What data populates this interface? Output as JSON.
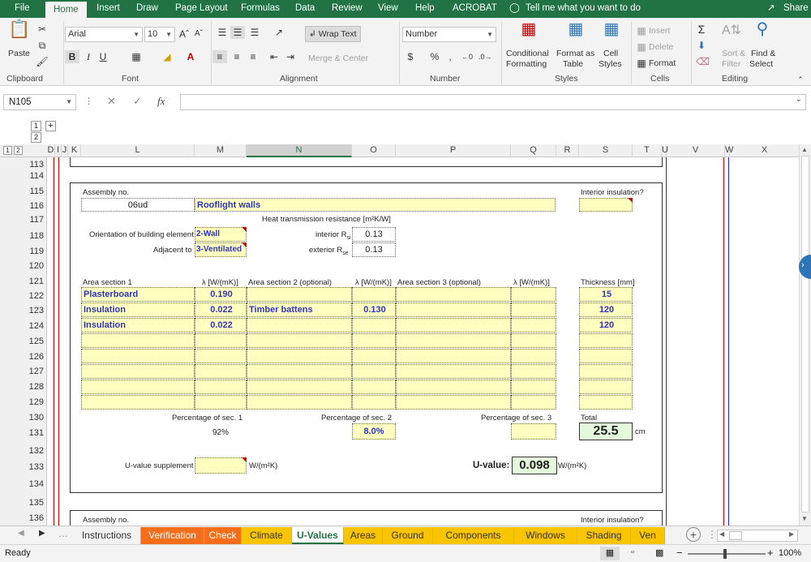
{
  "menu": {
    "items": [
      "File",
      "Home",
      "Insert",
      "Draw",
      "Page Layout",
      "Formulas",
      "Data",
      "Review",
      "View",
      "Help",
      "ACROBAT"
    ],
    "tell_me": "Tell me what you want to do",
    "share": "Share"
  },
  "ribbon": {
    "clipboard": {
      "paste": "Paste",
      "label": "Clipboard"
    },
    "font": {
      "name": "Arial",
      "size": "10",
      "label": "Font",
      "bold": "B",
      "italic": "I",
      "underline": "U"
    },
    "alignment": {
      "wrap": "Wrap Text",
      "merge": "Merge & Center",
      "label": "Alignment"
    },
    "number": {
      "format": "Number",
      "label": "Number",
      "currency": "$",
      "percent": "%",
      "comma": ","
    },
    "styles": {
      "conditional_1": "Conditional",
      "conditional_2": "Formatting",
      "format_table_1": "Format as",
      "format_table_2": "Table",
      "cell_styles_1": "Cell",
      "cell_styles_2": "Styles",
      "label": "Styles"
    },
    "cells": {
      "insert": "Insert",
      "delete": "Delete",
      "format": "Format",
      "label": "Cells"
    },
    "editing": {
      "sort_1": "Sort &",
      "sort_2": "Filter",
      "find_1": "Find &",
      "find_2": "Select",
      "label": "Editing"
    }
  },
  "formula_bar": {
    "name_box": "N105",
    "fx": "fx",
    "content": ""
  },
  "outline": {
    "levels": [
      "1",
      "2"
    ],
    "expand": "+"
  },
  "columns": [
    "D",
    "I",
    "J",
    "K",
    "L",
    "M",
    "N",
    "O",
    "P",
    "Q",
    "R",
    "S",
    "T",
    "U",
    "V",
    "W",
    "X"
  ],
  "rows": [
    "113",
    "114",
    "115",
    "116",
    "117",
    "118",
    "119",
    "120",
    "121",
    "122",
    "123",
    "124",
    "125",
    "126",
    "127",
    "128",
    "129",
    "130",
    "131",
    "132",
    "133",
    "134",
    "135",
    "136"
  ],
  "sheet": {
    "assembly_label": "Assembly no.",
    "assembly_no": "06ud",
    "assembly_name": "Rooflight walls",
    "interior_insulation_label": "Interior insulation?",
    "heat_label": "Heat transmission resistance  [m²K/W]",
    "orientation_label": "Orientation of building element",
    "orientation_value": "2-Wall",
    "adjacent_label": "Adjacent to",
    "adjacent_value": "3-Ventilated",
    "interior_r_label": "interior R",
    "interior_r_sub": "si",
    "interior_r_value": "0.13",
    "exterior_r_label": "exterior R",
    "exterior_r_sub": "se",
    "exterior_r_value": "0.13",
    "area1_label": "Area section 1",
    "lambda_label": "λ [W/(mK)]",
    "area2_label": "Area section 2 (optional)",
    "area3_label": "Area section 3 (optional)",
    "thickness_label": "Thickness [mm]",
    "layers": [
      {
        "a1": "Plasterboard",
        "l1": "0.190",
        "a2": "",
        "l2": "",
        "t": "15"
      },
      {
        "a1": "Insulation",
        "l1": "0.022",
        "a2": "Timber battens",
        "l2": "0.130",
        "t": "120"
      },
      {
        "a1": "Insulation",
        "l1": "0.022",
        "a2": "",
        "l2": "",
        "t": "120"
      }
    ],
    "pct1_label": "Percentage of sec. 1",
    "pct1_value": "92%",
    "pct2_label": "Percentage of sec. 2",
    "pct2_value": "8.0%",
    "pct3_label": "Percentage of sec. 3",
    "total_label": "Total",
    "total_value": "25.5",
    "total_unit": "cm",
    "supplement_label": "U-value supplement",
    "supplement_unit": "W/(m²K)",
    "uvalue_label": "U-value:",
    "uvalue_value": "0.098",
    "uvalue_unit": "W/(m²K)",
    "next_assembly_label": "Assembly no.",
    "next_interior_label": "Interior insulation?"
  },
  "tabs": [
    {
      "label": "Instructions",
      "color": "#f3f3f3",
      "text": "#333"
    },
    {
      "label": "Verification",
      "color": "#f56e1b",
      "text": "#fff"
    },
    {
      "label": "Check",
      "color": "#f56e1b",
      "text": "#fff"
    },
    {
      "label": "Climate",
      "color": "#f9c400",
      "text": "#333"
    },
    {
      "label": "U-Values",
      "color": "#ffffff",
      "text": "#217346"
    },
    {
      "label": "Areas",
      "color": "#f9c400",
      "text": "#333"
    },
    {
      "label": "Ground",
      "color": "#f9c400",
      "text": "#333"
    },
    {
      "label": "Components",
      "color": "#f9c400",
      "text": "#333"
    },
    {
      "label": "Windows",
      "color": "#f9c400",
      "text": "#333"
    },
    {
      "label": "Shading",
      "color": "#f9c400",
      "text": "#333"
    },
    {
      "label": "Ven",
      "color": "#f9c400",
      "text": "#333"
    }
  ],
  "status": {
    "ready": "Ready",
    "zoom": "100%"
  },
  "colors": {
    "excel_green": "#217346",
    "cell_yellow": "#ffffc0",
    "value_blue": "#2e35b8",
    "result_green": "#e4f8dc"
  }
}
